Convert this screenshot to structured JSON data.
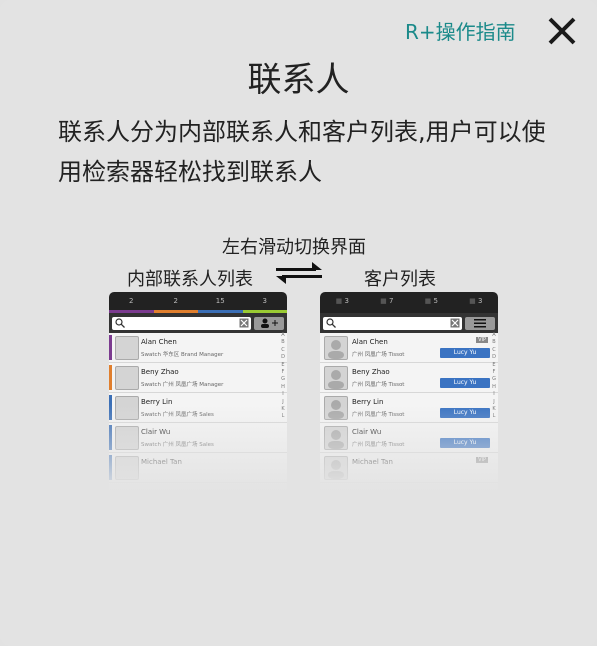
{
  "header": {
    "guide_link": "R+操作指南",
    "title": "联系人",
    "description": "联系人分为内部联系人和客户列表,用户可以使用检索器轻松找到联系人"
  },
  "illustration": {
    "swipe_hint": "左右滑动切换界面",
    "internal_label": "内部联系人列表",
    "client_label": "客户列表",
    "internal_tabs": [
      "2",
      "2",
      "15",
      "3"
    ],
    "client_tabs": [
      "3",
      "7",
      "5",
      "3"
    ],
    "client_tab_icons": [
      "vip-tag",
      "person",
      "person-plus",
      "pin"
    ],
    "internal_tab_colors": [
      "#7b3b8f",
      "#e07f2e",
      "#3b6fb6",
      "#9acb33"
    ],
    "alphabet": [
      "A",
      "B",
      "C",
      "D",
      "E",
      "F",
      "G",
      "H",
      "I",
      "J",
      "K",
      "L"
    ],
    "internal_rows": [
      {
        "name": "Alan Chen",
        "sub": "Swatch 华东区 Brand Manager",
        "color": "#7b3b8f"
      },
      {
        "name": "Beny Zhao",
        "sub": "Swatch 广州  凤凰广场  Manager",
        "color": "#e07f2e"
      },
      {
        "name": "Berry Lin",
        "sub": "Swatch 广州  凤凰广场  Sales",
        "color": "#3b6fb6"
      },
      {
        "name": "Clair Wu",
        "sub": "Swatch 广州  凤凰广场  Sales",
        "color": "#3b6fb6"
      },
      {
        "name": "Michael Tan",
        "sub": "",
        "color": "#3b6fb6"
      }
    ],
    "client_rows": [
      {
        "name": "Alan Chen",
        "sub": "广州  凤凰广场  Tissot",
        "owner": "Lucy Yu",
        "vip": "VIP"
      },
      {
        "name": "Beny Zhao",
        "sub": "广州  凤凰广场  Tissot",
        "owner": "Lucy Yu",
        "vip": ""
      },
      {
        "name": "Berry Lin",
        "sub": "广州  凤凰广场  Tissot",
        "owner": "Lucy Yu",
        "vip": ""
      },
      {
        "name": "Clair Wu",
        "sub": "广州  凤凰广场  Tissot",
        "owner": "Lucy Yu",
        "vip": ""
      },
      {
        "name": "Michael Tan",
        "sub": "",
        "owner": "",
        "vip": "VIP"
      }
    ]
  }
}
